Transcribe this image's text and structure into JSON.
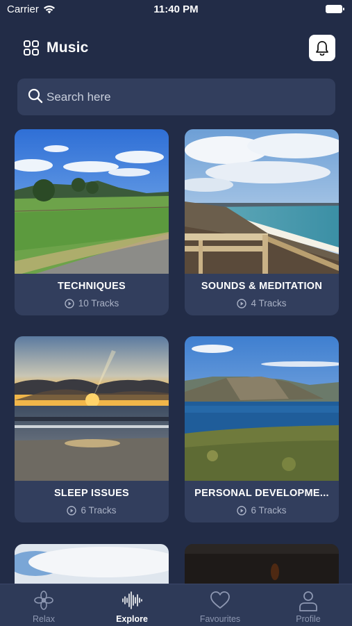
{
  "status_bar": {
    "carrier": "Carrier",
    "time": "11:40 PM"
  },
  "header": {
    "title": "Music"
  },
  "search": {
    "placeholder": "Search here"
  },
  "cards": [
    {
      "title": "TECHNIQUES",
      "tracks": "10 Tracks"
    },
    {
      "title": "SOUNDS & MEDITATION",
      "tracks": "4 Tracks"
    },
    {
      "title": "SLEEP ISSUES",
      "tracks": "6 Tracks"
    },
    {
      "title": "PERSONAL DEVELOPME...",
      "tracks": "6 Tracks"
    }
  ],
  "tabbar": {
    "items": [
      {
        "label": "Relax",
        "icon": "flower-icon",
        "active": false
      },
      {
        "label": "Explore",
        "icon": "soundwave-icon",
        "active": true
      },
      {
        "label": "Favourites",
        "icon": "heart-icon",
        "active": false
      },
      {
        "label": "Profile",
        "icon": "person-icon",
        "active": false
      }
    ]
  },
  "colors": {
    "background": "#222c47",
    "card": "#323e5d",
    "tabbar": "#2e3a58"
  }
}
